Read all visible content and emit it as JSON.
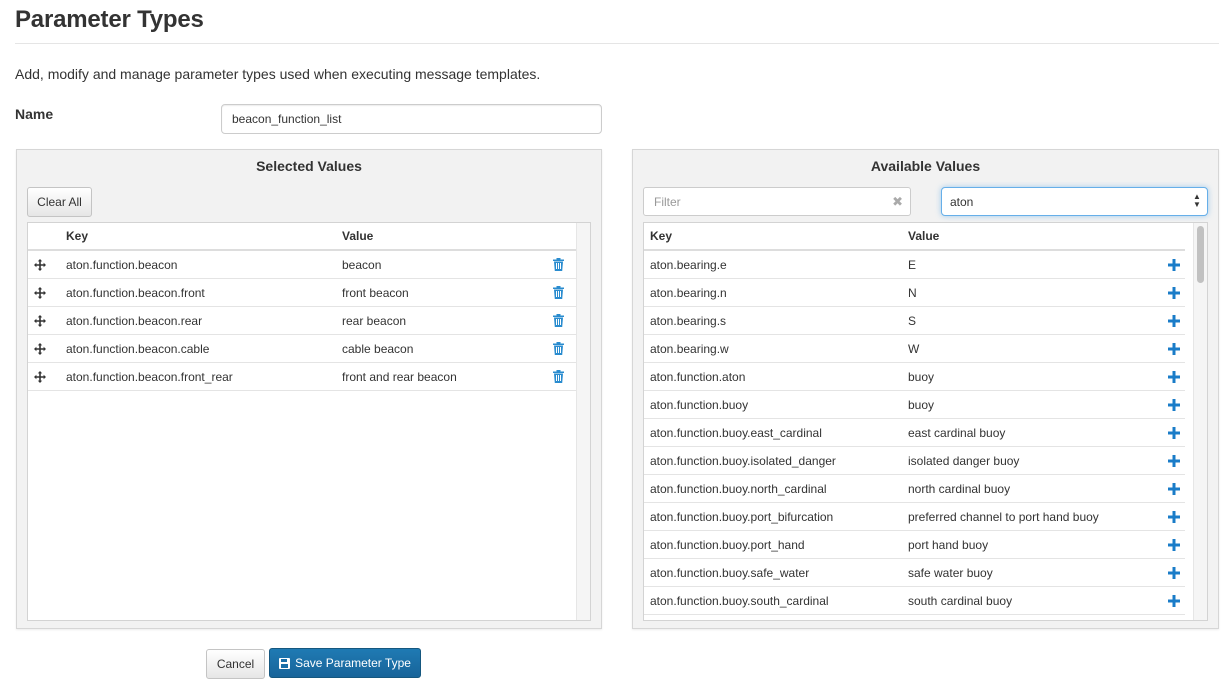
{
  "page": {
    "title": "Parameter Types",
    "description": "Add, modify and manage parameter types used when executing message templates."
  },
  "form": {
    "name_label": "Name",
    "name_value": "beacon_function_list"
  },
  "selected": {
    "heading": "Selected Values",
    "clear_all_label": "Clear All",
    "columns": {
      "key": "Key",
      "value": "Value"
    },
    "rows": [
      {
        "key": "aton.function.beacon",
        "value": "beacon"
      },
      {
        "key": "aton.function.beacon.front",
        "value": "front beacon"
      },
      {
        "key": "aton.function.beacon.rear",
        "value": "rear beacon"
      },
      {
        "key": "aton.function.beacon.cable",
        "value": "cable beacon"
      },
      {
        "key": "aton.function.beacon.front_rear",
        "value": "front and rear beacon"
      }
    ]
  },
  "available": {
    "heading": "Available Values",
    "filter_placeholder": "Filter",
    "filter_clear_glyph": "✖",
    "select_value": "aton",
    "columns": {
      "key": "Key",
      "value": "Value"
    },
    "rows": [
      {
        "key": "aton.bearing.e",
        "value": "E"
      },
      {
        "key": "aton.bearing.n",
        "value": "N"
      },
      {
        "key": "aton.bearing.s",
        "value": "S"
      },
      {
        "key": "aton.bearing.w",
        "value": "W"
      },
      {
        "key": "aton.function.aton",
        "value": "buoy"
      },
      {
        "key": "aton.function.buoy",
        "value": "buoy"
      },
      {
        "key": "aton.function.buoy.east_cardinal",
        "value": "east cardinal buoy"
      },
      {
        "key": "aton.function.buoy.isolated_danger",
        "value": "isolated danger buoy"
      },
      {
        "key": "aton.function.buoy.north_cardinal",
        "value": "north cardinal buoy"
      },
      {
        "key": "aton.function.buoy.port_bifurcation",
        "value": "preferred channel to port hand buoy"
      },
      {
        "key": "aton.function.buoy.port_hand",
        "value": "port hand buoy"
      },
      {
        "key": "aton.function.buoy.safe_water",
        "value": "safe water buoy"
      },
      {
        "key": "aton.function.buoy.south_cardinal",
        "value": "south cardinal buoy"
      }
    ]
  },
  "actions": {
    "cancel_label": "Cancel",
    "save_label": "Save Parameter Type"
  },
  "icons": {
    "move": "arrows-move-icon",
    "delete": "trash-icon",
    "add": "plus-icon",
    "save": "floppy-disk-icon"
  },
  "colors": {
    "primary": "#1a6fa8",
    "icon_accent": "#2a8ccf"
  }
}
